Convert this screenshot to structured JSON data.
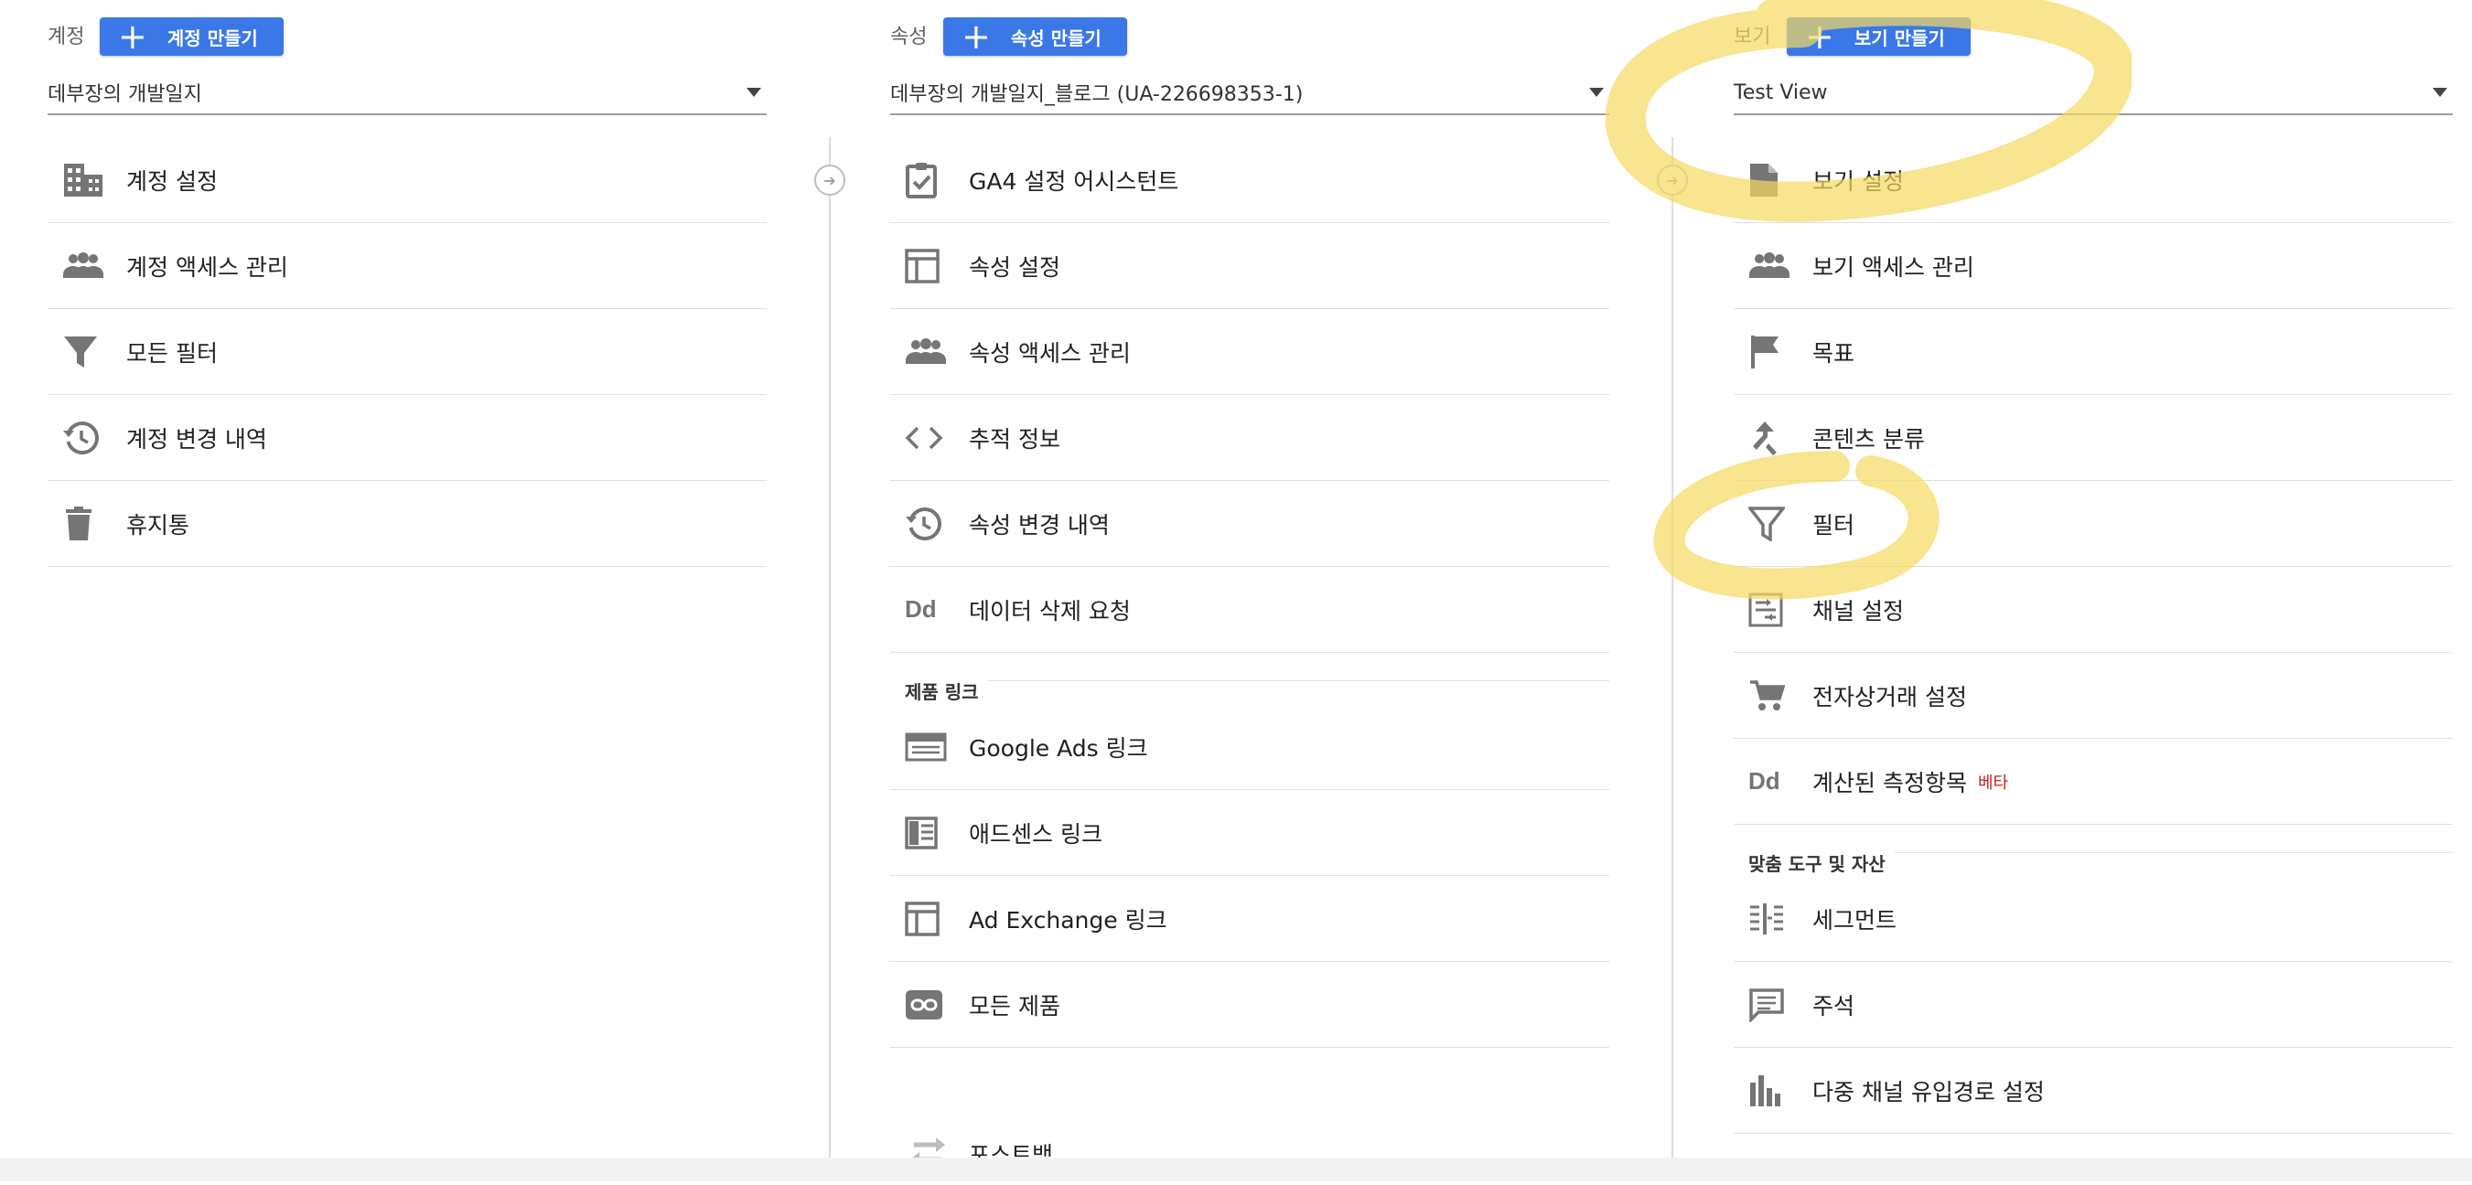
{
  "columns": {
    "account": {
      "label": "계정",
      "create_label": "계정 만들기",
      "selected": "데부장의 개발일지",
      "items": [
        {
          "label": "계정 설정",
          "icon": "building-icon"
        },
        {
          "label": "계정 액세스 관리",
          "icon": "people-icon"
        },
        {
          "label": "모든 필터",
          "icon": "filter-icon"
        },
        {
          "label": "계정 변경 내역",
          "icon": "history-icon"
        },
        {
          "label": "휴지통",
          "icon": "trash-icon"
        }
      ]
    },
    "property": {
      "label": "속성",
      "create_label": "속성 만들기",
      "selected": "데부장의 개발일지_블로그 (UA-226698353-1)",
      "items": [
        {
          "label": "GA4 설정 어시스턴트",
          "icon": "clipboard-check-icon"
        },
        {
          "label": "속성 설정",
          "icon": "layout-icon"
        },
        {
          "label": "속성 액세스 관리",
          "icon": "people-icon"
        },
        {
          "label": "추적 정보",
          "icon": "code-icon"
        },
        {
          "label": "속성 변경 내역",
          "icon": "history-icon"
        },
        {
          "label": "데이터 삭제 요청",
          "icon": "dd-icon",
          "glyph": "Dd"
        }
      ],
      "section_title": "제품 링크",
      "section_items": [
        {
          "label": "Google Ads 링크",
          "icon": "ads-icon"
        },
        {
          "label": "애드센스 링크",
          "icon": "adsense-icon"
        },
        {
          "label": "Ad Exchange 링크",
          "icon": "layout-icon"
        },
        {
          "label": "모든 제품",
          "icon": "link-icon"
        },
        {
          "label": "포스트백",
          "icon": "swap-icon"
        }
      ]
    },
    "view": {
      "label": "보기",
      "create_label": "보기 만들기",
      "selected": "Test View",
      "items": [
        {
          "label": "보기 설정",
          "icon": "document-icon"
        },
        {
          "label": "보기 액세스 관리",
          "icon": "people-icon"
        },
        {
          "label": "목표",
          "icon": "flag-icon"
        },
        {
          "label": "콘텐츠 분류",
          "icon": "merge-icon"
        },
        {
          "label": "필터",
          "icon": "filter-icon"
        },
        {
          "label": "채널 설정",
          "icon": "channel-icon"
        },
        {
          "label": "전자상거래 설정",
          "icon": "cart-icon"
        },
        {
          "label": "계산된 측정항목",
          "icon": "dd-icon",
          "glyph": "Dd",
          "badge": "베타"
        }
      ],
      "section_title": "맞춤 도구 및 자산",
      "section_items": [
        {
          "label": "세그먼트",
          "icon": "segment-icon"
        },
        {
          "label": "주석",
          "icon": "comment-icon"
        },
        {
          "label": "다중 채널 유입경로 설정",
          "icon": "bar-chart-icon"
        }
      ]
    }
  },
  "colors": {
    "button": "#3b78e7",
    "highlighter": "#f6d860",
    "beta": "#c5221f",
    "icon": "#757575"
  }
}
